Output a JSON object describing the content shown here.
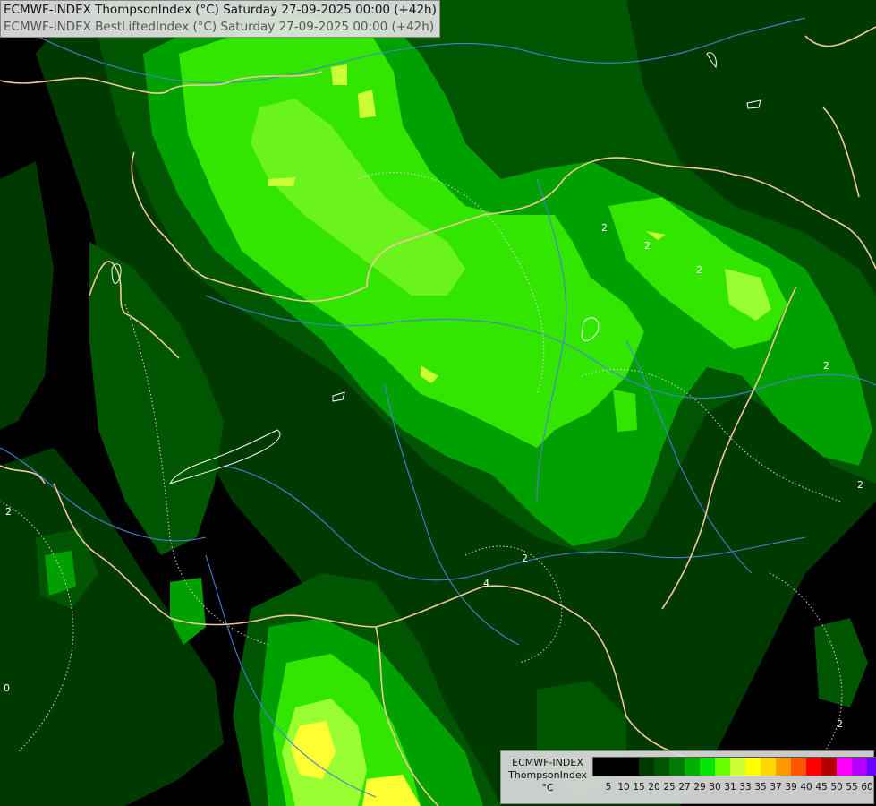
{
  "header": {
    "line1": "ECMWF-INDEX ThompsonIndex (°C) Saturday 27-09-2025 00:00 (+42h)",
    "line2": "ECMWF-INDEX BestLiftedIndex (°C) Saturday 27-09-2025 00:00 (+42h)"
  },
  "legend": {
    "model": "ECMWF-INDEX",
    "parameter": "ThompsonIndex",
    "unit": "°C",
    "ticks": [
      "5",
      "10",
      "15",
      "20",
      "25",
      "27",
      "29",
      "30",
      "31",
      "33",
      "35",
      "37",
      "39",
      "40",
      "45",
      "50",
      "55",
      "60"
    ],
    "colors": [
      "#000000",
      "#000000",
      "#000000",
      "#003a00",
      "#005500",
      "#007a00",
      "#00b000",
      "#00e600",
      "#66ff00",
      "#ccff33",
      "#ffff00",
      "#ffd700",
      "#ff9900",
      "#ff5500",
      "#ff0000",
      "#b40000",
      "#ff00ff",
      "#b400ff",
      "#6a00ff",
      "#0000ff"
    ]
  },
  "map": {
    "contour_labels": [
      "2",
      "2",
      "2",
      "2",
      "2",
      "2",
      "2",
      "2",
      "4",
      "0"
    ],
    "colors": {
      "background": "#000000",
      "border": "#f5c89a",
      "river": "#4a7fd4",
      "contour": "#dddddd"
    }
  }
}
